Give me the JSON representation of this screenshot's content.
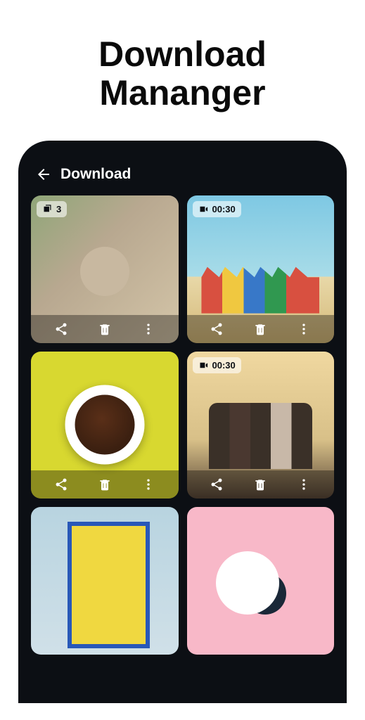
{
  "promo": {
    "title_line1": "Download",
    "title_line2": "Mananger"
  },
  "header": {
    "title": "Download"
  },
  "items": [
    {
      "badge_type": "stack",
      "badge_text": "3"
    },
    {
      "badge_type": "video",
      "badge_text": "00:30"
    },
    {
      "badge_type": "none",
      "badge_text": ""
    },
    {
      "badge_type": "video",
      "badge_text": "00:30"
    },
    {
      "badge_type": "none",
      "badge_text": ""
    },
    {
      "badge_type": "none",
      "badge_text": ""
    }
  ]
}
